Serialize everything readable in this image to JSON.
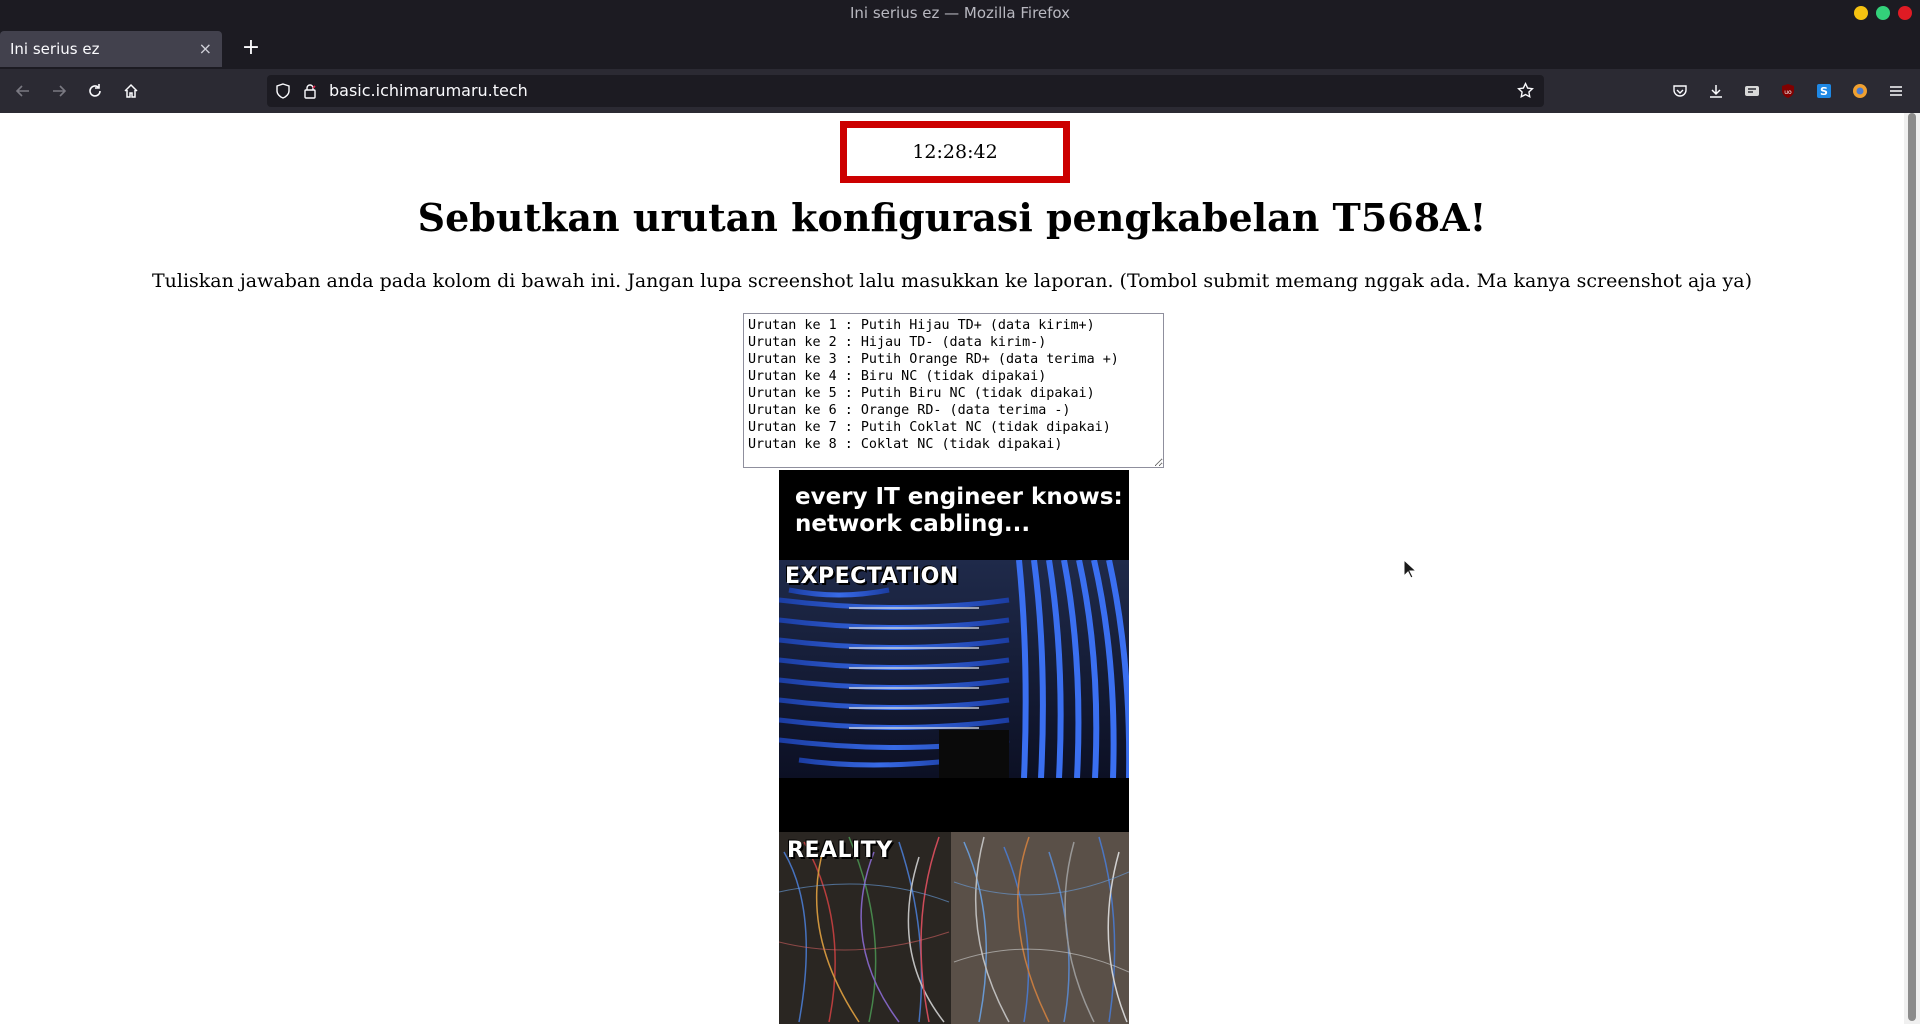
{
  "window": {
    "title": "Ini serius ez — Mozilla Firefox",
    "controls": [
      {
        "name": "minimize",
        "color": "#f5c211"
      },
      {
        "name": "maximize",
        "color": "#33d17a"
      },
      {
        "name": "close",
        "color": "#e01b24"
      }
    ]
  },
  "tabs": [
    {
      "label": "Ini serius ez",
      "close": "×"
    }
  ],
  "new_tab_label": "+",
  "url": "basic.ichimarumaru.tech",
  "page": {
    "clock": "12:28:42",
    "heading": "Sebutkan urutan konfigurasi pengkabelan T568A!",
    "subtitle": "Tuliskan jawaban anda pada kolom di bawah ini. Jangan lupa screenshot lalu masukkan ke laporan. (Tombol submit memang nggak ada. Ma kanya screenshot aja ya)",
    "answer": "Urutan ke 1 : Putih Hijau TD+ (data kirim+)\nUrutan ke 2 : Hijau TD- (data kirim-)\nUrutan ke 3 : Putih Orange RD+ (data terima +)\nUrutan ke 4 : Biru NC (tidak dipakai)\nUrutan ke 5 : Putih Biru NC (tidak dipakai)\nUrutan ke 6 : Orange RD- (data terima -)\nUrutan ke 7 : Putih Coklat NC (tidak dipakai)\nUrutan ke 8 : Coklat NC (tidak dipakai)",
    "meme": {
      "caption_line1": "every IT engineer knows:",
      "caption_line2": "network cabling...",
      "label_expectation": "EXPECTATION",
      "label_reality": "REALITY"
    }
  },
  "colors": {
    "clock_border": "#cc0000",
    "chrome_dark": "#1c1b22",
    "cable_blue": "#2f5fd0"
  }
}
